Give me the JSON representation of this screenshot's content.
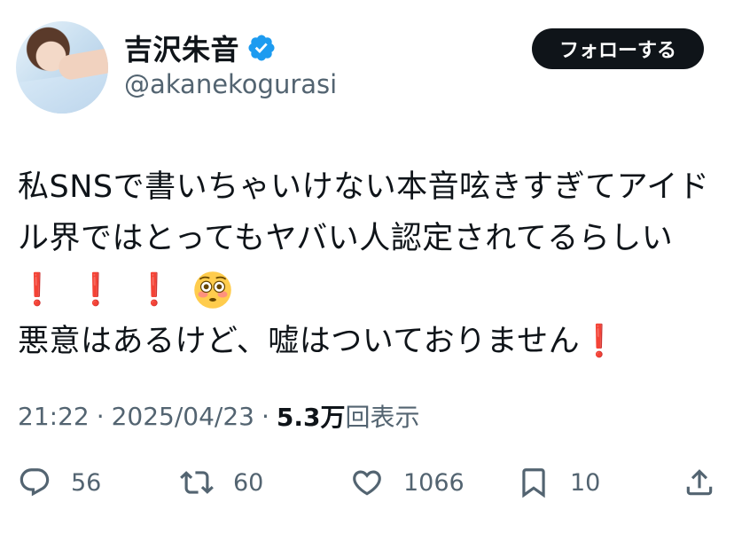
{
  "author": {
    "display_name": "吉沢朱音",
    "handle": "@akanekogurasi",
    "verified_icon": "verified-badge",
    "verified_color": "#1d9bf0"
  },
  "follow_button": {
    "label": "フォローする"
  },
  "tweet": {
    "lines": [
      "私SNSで書いちゃいけない本音呟きすぎてアイド",
      "ル界ではとってもヤバい人認定されてるらしい"
    ],
    "exclamations": [
      "❗",
      "❗",
      "❗"
    ],
    "emoji": "😳",
    "last_line": "悪意はあるけど、嘘はついておりません",
    "last_line_mark": "❗"
  },
  "meta": {
    "time": "21:22",
    "separator": "·",
    "date": "2025/04/23",
    "views_count": "5.3万",
    "views_label": "回表示"
  },
  "actions": {
    "replies": "56",
    "reposts": "60",
    "likes": "1066",
    "bookmarks": "10",
    "icons": [
      "reply-icon",
      "repost-icon",
      "like-icon",
      "bookmark-icon",
      "share-icon"
    ]
  },
  "colors": {
    "text": "#0f1419",
    "secondary": "#536471",
    "accent_red": "#dd2e44",
    "button_bg": "#0f1419"
  }
}
